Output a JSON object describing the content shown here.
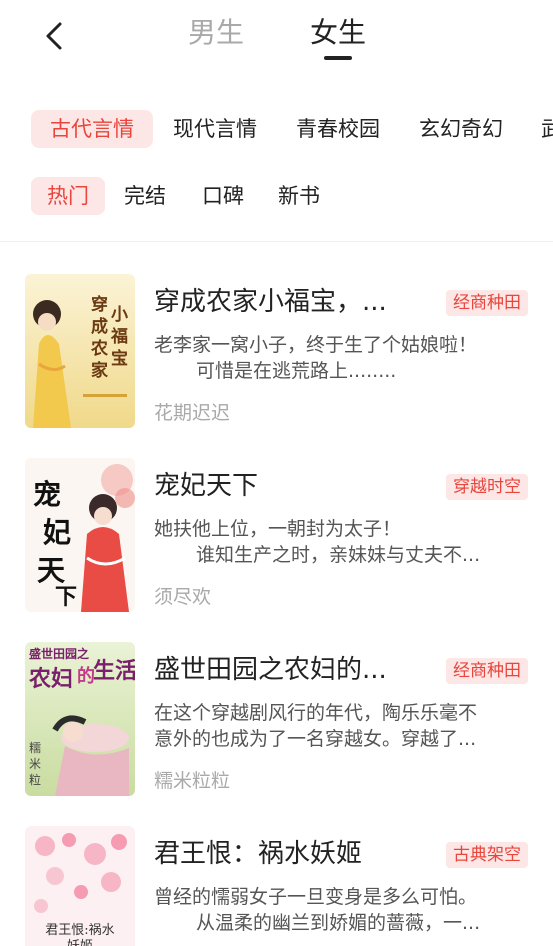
{
  "header": {
    "tabs": [
      {
        "label": "男生",
        "active": false
      },
      {
        "label": "女生",
        "active": true
      }
    ]
  },
  "categories": [
    "古代言情",
    "现代言情",
    "青春校园",
    "玄幻奇幻",
    "武"
  ],
  "sort_options": [
    "热门",
    "完结",
    "口碑",
    "新书"
  ],
  "books": [
    {
      "title": "穿成农家小福宝，...",
      "tag": "经商种田",
      "desc_line1": "老李家一窝小子，终于生了个姑娘啦！",
      "desc_line2": "可惜是在逃荒路上........",
      "author": "花期迟迟",
      "cover_text": "穿成农家小福宝"
    },
    {
      "title": "宠妃天下",
      "tag": "穿越时空",
      "desc_line1": "她扶他上位，一朝封为太子！",
      "desc_line2": "谁知生产之时，亲妹妹与丈夫不...",
      "author": "须尽欢",
      "cover_text": "宠妃天下"
    },
    {
      "title": "盛世田园之农妇的...",
      "tag": "经商种田",
      "desc_line1": "在这个穿越剧风行的年代，陶乐乐毫不",
      "desc_line2": "意外的也成为了一名穿越女。穿越了...",
      "author": "糯米粒粒",
      "cover_text": "盛世田园之农妇"
    },
    {
      "title": "君王恨：祸水妖姬",
      "tag": "古典架空",
      "desc_line1": "曾经的懦弱女子一旦变身是多么可怕。",
      "desc_line2": "从温柔的幽兰到娇媚的蔷薇，一...",
      "author": "",
      "cover_text": "君王恨:祸水妖姬"
    }
  ],
  "colors": {
    "accent": "#e8453c",
    "accent_bg": "#fde6e6",
    "muted": "#a9a9a9"
  }
}
